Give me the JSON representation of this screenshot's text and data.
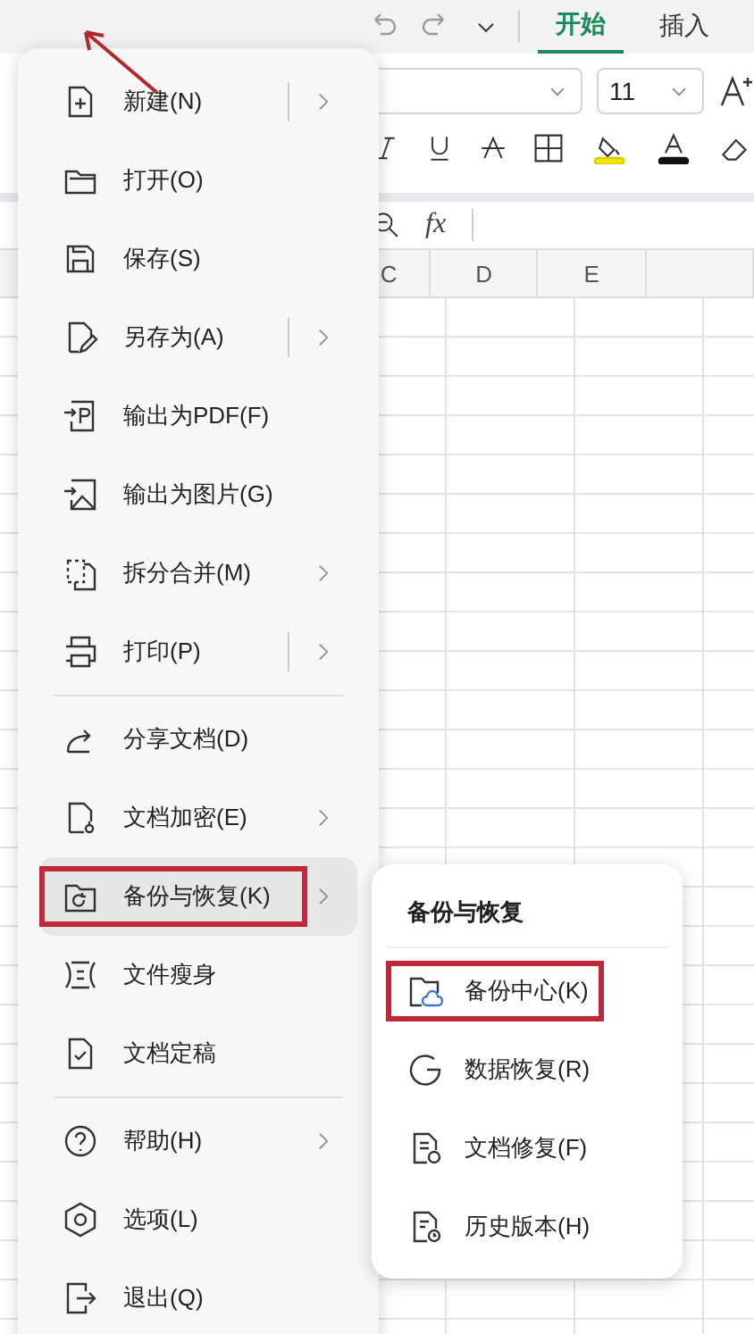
{
  "ribbon_tabs": [
    {
      "label": "开始",
      "selected": true
    },
    {
      "label": "插入",
      "selected": false
    }
  ],
  "font_size": {
    "value": "11"
  },
  "formula_bar": {
    "function_label": "fx"
  },
  "columns": [
    "C",
    "D",
    "E"
  ],
  "file_menu": {
    "groups": [
      {
        "items": [
          {
            "label": "新建(N)",
            "kind": "split",
            "selected": false,
            "marked": false
          },
          {
            "label": "打开(O)",
            "kind": "plain",
            "selected": false,
            "marked": false
          },
          {
            "label": "保存(S)",
            "kind": "plain",
            "selected": false,
            "marked": false
          },
          {
            "label": "另存为(A)",
            "kind": "split",
            "selected": false,
            "marked": false
          },
          {
            "label": "输出为PDF(F)",
            "kind": "plain",
            "selected": false,
            "marked": false
          },
          {
            "label": "输出为图片(G)",
            "kind": "plain",
            "selected": false,
            "marked": false
          },
          {
            "label": "拆分合并(M)",
            "kind": "submenu",
            "selected": false,
            "marked": false
          },
          {
            "label": "打印(P)",
            "kind": "split",
            "selected": false,
            "marked": false
          }
        ]
      },
      {
        "items": [
          {
            "label": "分享文档(D)",
            "kind": "plain",
            "selected": false,
            "marked": false
          },
          {
            "label": "文档加密(E)",
            "kind": "submenu",
            "selected": false,
            "marked": false
          },
          {
            "label": "备份与恢复(K)",
            "kind": "submenu",
            "selected": true,
            "marked": true
          },
          {
            "label": "文件瘦身",
            "kind": "plain",
            "selected": false,
            "marked": false
          },
          {
            "label": "文档定稿",
            "kind": "plain",
            "selected": false,
            "marked": false
          }
        ]
      },
      {
        "items": [
          {
            "label": "帮助(H)",
            "kind": "submenu",
            "selected": false,
            "marked": false
          },
          {
            "label": "选项(L)",
            "kind": "plain",
            "selected": false,
            "marked": false
          },
          {
            "label": "退出(Q)",
            "kind": "plain",
            "selected": false,
            "marked": false
          }
        ]
      }
    ]
  },
  "submenu": {
    "title": "备份与恢复",
    "items": [
      {
        "label": "备份中心(K)",
        "marked": true
      },
      {
        "label": "数据恢复(R)",
        "marked": false
      },
      {
        "label": "文档修复(F)",
        "marked": false
      },
      {
        "label": "历史版本(H)",
        "marked": false
      }
    ]
  }
}
